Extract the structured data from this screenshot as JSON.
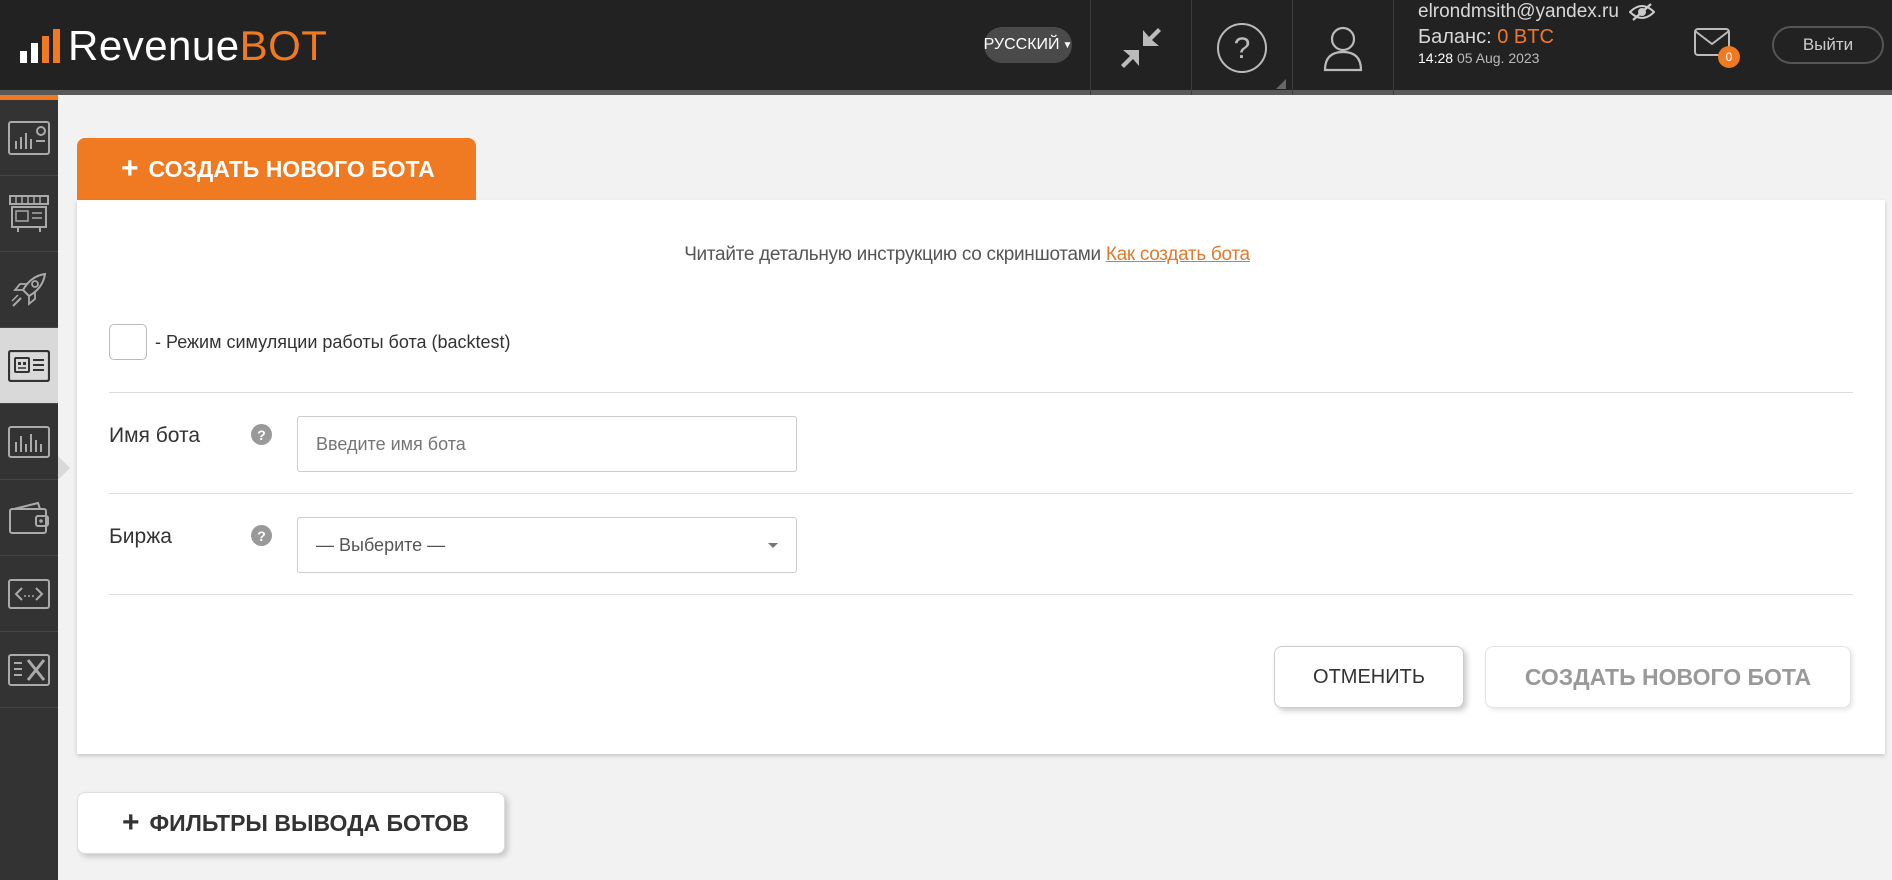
{
  "header": {
    "logo_main": "Revenue",
    "logo_accent": "BOT",
    "language": "РУССКИЙ",
    "email": "elrondmsith@yandex.ru",
    "balance_label": "Баланс:",
    "balance_value": "0 BTC",
    "time": "14:28",
    "date": "05 Aug. 2023",
    "mail_count": "0",
    "logout_label": "Выйти"
  },
  "sidebar": {
    "items": [
      {
        "icon": "dashboard-icon"
      },
      {
        "icon": "marketplace-icon"
      },
      {
        "icon": "rocket-icon"
      },
      {
        "icon": "bots-icon",
        "active": true
      },
      {
        "icon": "statistics-icon"
      },
      {
        "icon": "wallet-icon"
      },
      {
        "icon": "api-icon"
      },
      {
        "icon": "tools-icon"
      }
    ]
  },
  "main": {
    "create_tab_label": "СОЗДАТЬ НОВОГО БОТА",
    "instruction_text": "Читайте детальную инструкцию со скриншотами ",
    "instruction_link": "Как создать бота",
    "backtest_label": "- Режим симуляции работы бота (backtest)",
    "bot_name_label": "Имя бота",
    "bot_name_placeholder": "Введите имя бота",
    "exchange_label": "Биржа",
    "exchange_selected": "— Выберите —",
    "cancel_label": "ОТМЕНИТЬ",
    "create_label": "СОЗДАТЬ НОВОГО БОТА",
    "filters_label": "ФИЛЬТРЫ ВЫВОДА БОТОВ"
  },
  "colors": {
    "accent": "#f07a22",
    "header_bg": "#222222",
    "sidebar_bg": "#333333"
  }
}
